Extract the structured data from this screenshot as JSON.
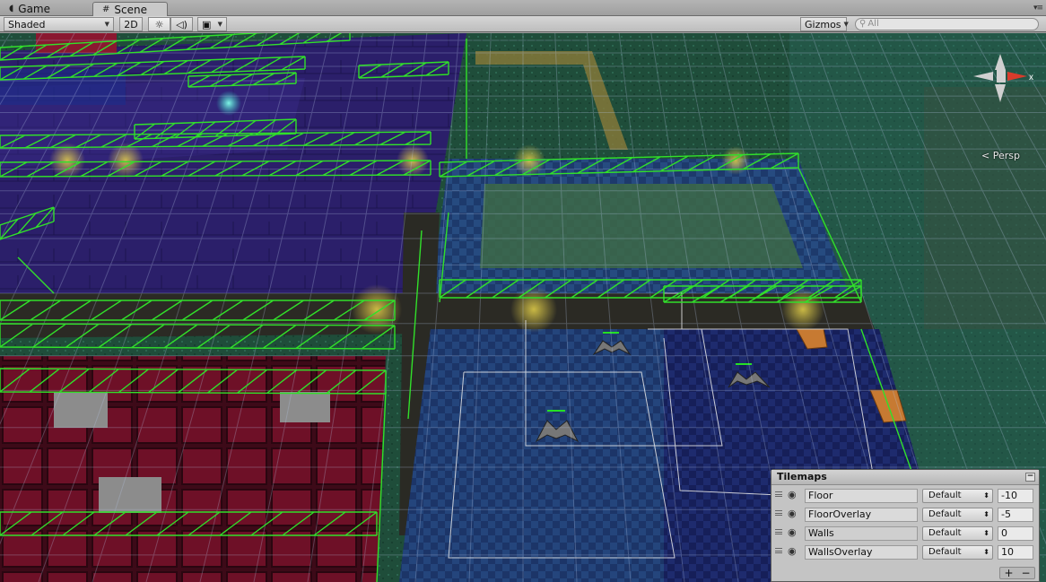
{
  "tabs": [
    {
      "label": "Game",
      "icon": "pacman-icon"
    },
    {
      "label": "Scene",
      "icon": "hash-icon",
      "active": true
    }
  ],
  "toolbar": {
    "draw_mode": "Shaded",
    "mode_2d": "2D",
    "lighting_icon": "sun-icon",
    "audio_icon": "speaker-icon",
    "effects_icon": "image-icon",
    "gizmos_label": "Gizmos",
    "search_placeholder": "All"
  },
  "viewport": {
    "projection_label": "< Persp",
    "gizmo_axis_label": "x"
  },
  "colors": {
    "wireframe": "#31e02a",
    "grid": "#b7c8e8",
    "gizmo_red": "#d93b2b",
    "gizmo_gray": "#d0d0d0"
  },
  "tilemaps": {
    "title": "Tilemaps",
    "rows": [
      {
        "name": "Floor",
        "sorting_layer": "Default",
        "order": "-10"
      },
      {
        "name": "FloorOverlay",
        "sorting_layer": "Default",
        "order": "-5"
      },
      {
        "name": "Walls",
        "sorting_layer": "Default",
        "order": "0"
      },
      {
        "name": "WallsOverlay",
        "sorting_layer": "Default",
        "order": "10"
      }
    ],
    "add_label": "+",
    "remove_label": "−"
  }
}
